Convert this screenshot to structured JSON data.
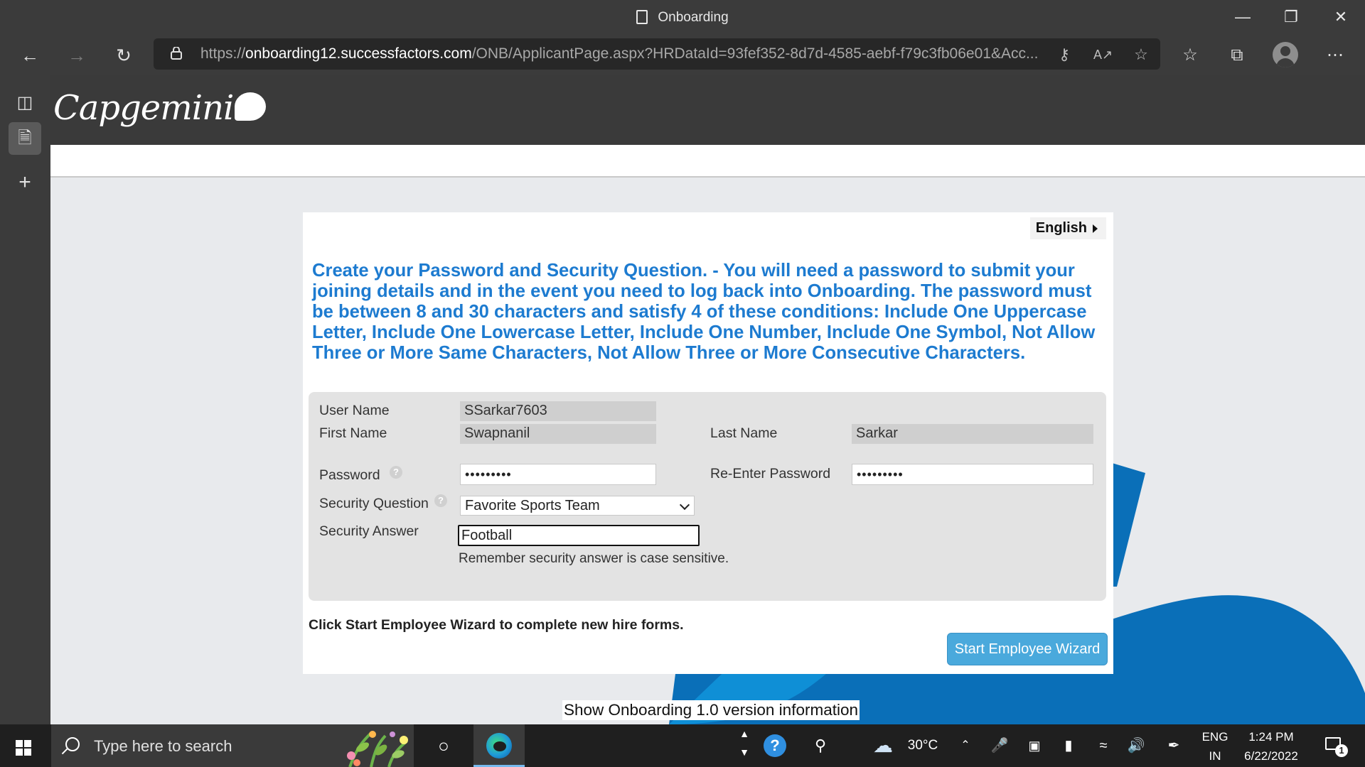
{
  "browser": {
    "tab_title": "Onboarding",
    "url_prefix": "https://",
    "url_host": "onboarding12.successfactors.com",
    "url_path": "/ONB/ApplicantPage.aspx?HRDataId=93fef352-8d7d-4585-aebf-f79c3fb06e01&Acc..."
  },
  "brand": {
    "logo_text": "Capgemini"
  },
  "page": {
    "language": "English",
    "intro": "Create your Password and Security Question. - You will need a password to submit your joining details and in the event you need to log back into Onboarding. The password must be between 8 and 30 characters and satisfy 4 of these conditions: Include One Uppercase Letter, Include One Lowercase Letter, Include One Number, Include One Symbol, Not Allow Three or More Same Characters, Not Allow Three or More Consecutive Characters.",
    "form": {
      "username_label": "User Name",
      "username_value": "SSarkar7603",
      "firstname_label": "First Name",
      "firstname_value": "Swapnanil",
      "lastname_label": "Last Name",
      "lastname_value": "Sarkar",
      "password_label": "Password",
      "password_value": "•••••••••",
      "reenter_label": "Re-Enter Password",
      "reenter_value": "•••••••••",
      "security_question_label": "Security Question",
      "security_question_value": "Favorite Sports Team",
      "security_answer_label": "Security Answer",
      "security_answer_value": "Football",
      "hint": "Remember security answer is case sensitive.",
      "help_glyph": "?"
    },
    "wizard_text": "Click Start Employee Wizard to complete new hire forms.",
    "wizard_button": "Start Employee Wizard",
    "version_link": "Show Onboarding 1.0 version information"
  },
  "taskbar": {
    "search_placeholder": "Type here to search",
    "weather": "30°C",
    "lang_top": "ENG",
    "lang_bottom": "IN",
    "time": "1:24 PM",
    "date": "6/22/2022",
    "notification_count": "1"
  },
  "colors": {
    "intro_blue": "#1d7bd0",
    "button_blue": "#4aa9dc",
    "wave_blue": "#0a6fb8",
    "chrome_dark": "#3b3b3b"
  }
}
